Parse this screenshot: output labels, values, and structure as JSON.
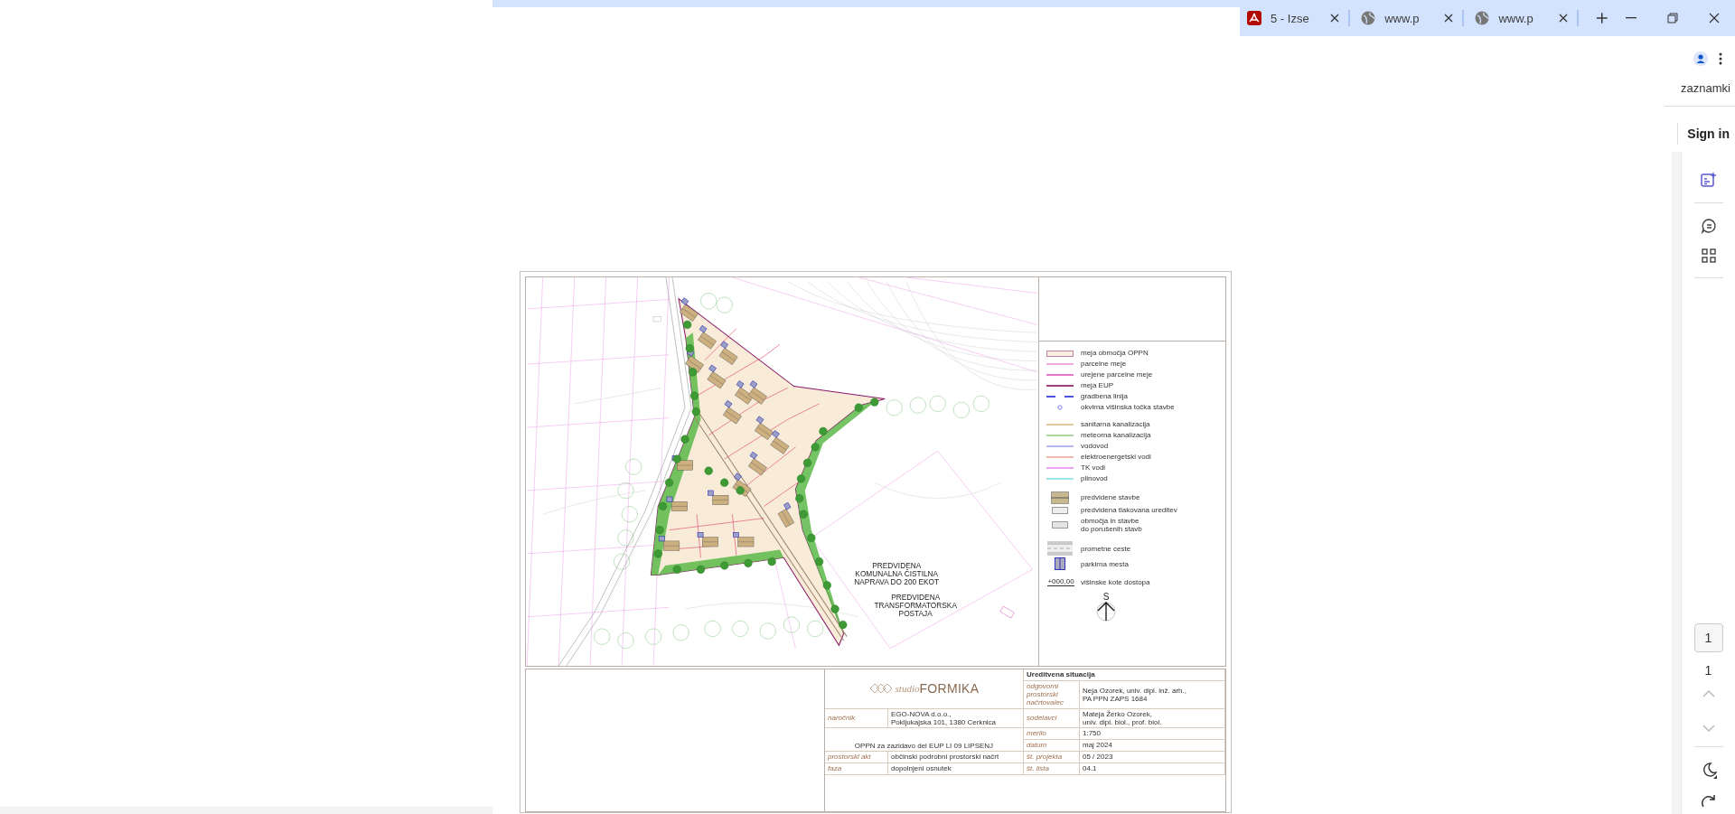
{
  "browser": {
    "tabs": [
      {
        "kind": "pdf",
        "title": "5 - Izse"
      },
      {
        "kind": "web",
        "title": "www.p"
      },
      {
        "kind": "web",
        "title": "www.p"
      }
    ]
  },
  "panel": {
    "heading": "zaznamki",
    "sign_in": "Sign in"
  },
  "viewer": {
    "page_input": "1",
    "page_total": "1"
  },
  "document": {
    "plan_labels": [
      "PREDVIDENA\nKOMUNALNA ČISTILNA\nNAPRAVA DO 200 EKOT",
      "PREDVIDENA\nTRANSFORMATORSKA\nPOSTAJA"
    ],
    "legend": [
      {
        "kind": "area",
        "label": "meja območja OPPN"
      },
      {
        "kind": "line",
        "label": "parcelne meje",
        "color": "#f0a8e0"
      },
      {
        "kind": "line",
        "label": "urejene parcelne meje",
        "color": "#e878c8"
      },
      {
        "kind": "line",
        "label": "meja EUP",
        "color": "#a0407a"
      },
      {
        "kind": "dash",
        "label": "gradbena linija",
        "color": "#5050e0"
      },
      {
        "kind": "point",
        "label": "okvirna višinska točka stavbe"
      },
      {
        "kind": "gap"
      },
      {
        "kind": "line",
        "label": "sanitarna kanalizacija",
        "color": "#e8c8a0"
      },
      {
        "kind": "line",
        "label": "meteorna kanalizacija",
        "color": "#a8d8a0"
      },
      {
        "kind": "line",
        "label": "vodovod",
        "color": "#b8b8f0"
      },
      {
        "kind": "line",
        "label": "elektroenergetski vodi",
        "color": "#f0b8a8"
      },
      {
        "kind": "line",
        "label": "TK vodi",
        "color": "#f0a0f0"
      },
      {
        "kind": "line",
        "label": "plinovod",
        "color": "#a0e8e8"
      },
      {
        "kind": "gap"
      },
      {
        "kind": "building",
        "label": "predvidene stavbe"
      },
      {
        "kind": "paving",
        "label": "predvidena tlakovana ureditev"
      },
      {
        "kind": "existing",
        "label": "območja in stavbe\ndo porušenih stavb"
      },
      {
        "kind": "gap"
      },
      {
        "kind": "road",
        "label": "prometne ceste"
      },
      {
        "kind": "parking",
        "label": "parkirna mesta"
      },
      {
        "kind": "elevation",
        "label": "višinske kote dostopa",
        "value": "+000,00"
      }
    ],
    "north": "S",
    "title_block": {
      "logo_prefix": "studio",
      "logo_name": "FORMIKA",
      "sheet_title": "Ureditvena situacija",
      "planner_label": "odgovorni prostorski načrtovalec",
      "planner": "Neja Ozorek, univ. dipl. inž. arh.,\nPA PPN ZAPS 1684",
      "client_label": "naročnik",
      "client": "EGO-NOVA d.o.o.,\nPokljukajska 101, 1380 Cerknica",
      "staff_label": "sodelavci",
      "staff": "Mateja Žerko Ozorek,\nuniv. dipl. biol., prof. biol.",
      "scale_label": "merilo",
      "scale": "1:750",
      "project": "OPPN za zazidavo del EUP LI 09 LIPSENJ",
      "date_label": "datum",
      "date": "maj 2024",
      "act_label": "prostorski akt",
      "act": "občinski podrobni prostorski načrt",
      "number_label": "št. projekta",
      "number": "05 / 2023",
      "phase_label": "faza",
      "phase": "dopolnjeni osnutek",
      "sheet_label": "št. lista",
      "sheet": "04.1"
    }
  }
}
